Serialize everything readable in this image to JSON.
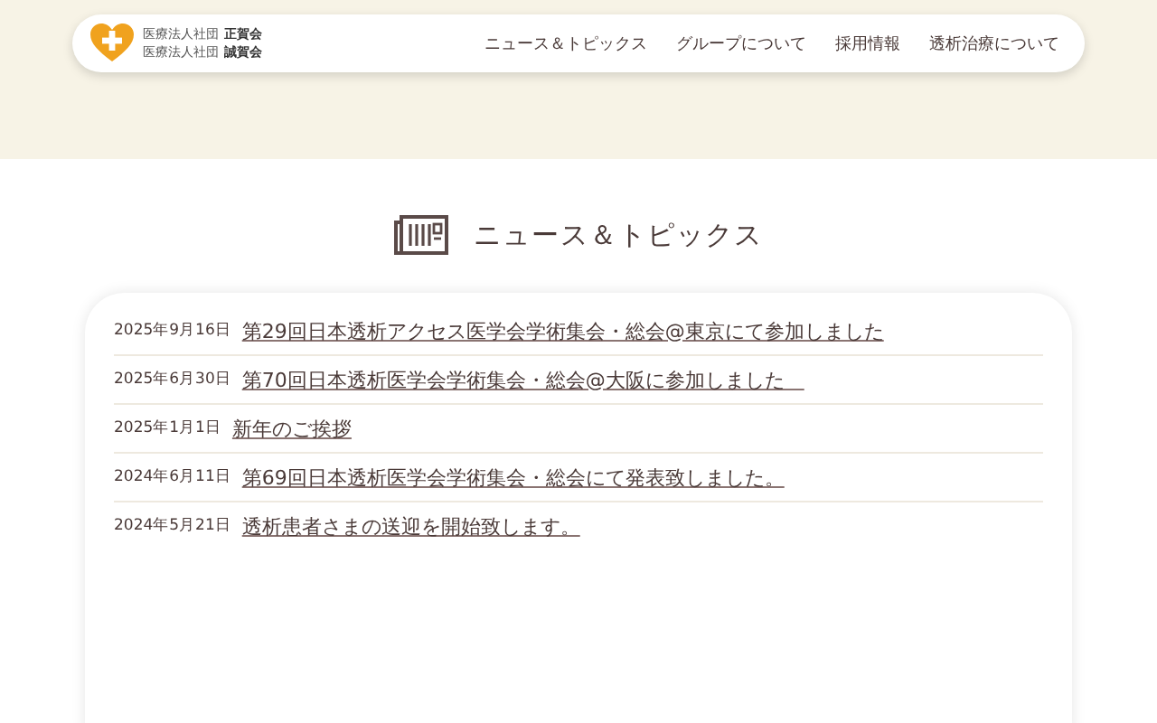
{
  "logo": {
    "lines": [
      {
        "prefix": "医療法人社団",
        "name": "正賀会"
      },
      {
        "prefix": "医療法人社団",
        "name": "誠賀会"
      }
    ]
  },
  "nav": [
    "ニュース＆トピックス",
    "グループについて",
    "採用情報",
    "透析治療について"
  ],
  "section_title": "ニュース＆トピックス",
  "news": [
    {
      "date": "2025年9月16日",
      "title": "第29回日本透析アクセス医学会学術集会・総会@東京にて参加しました"
    },
    {
      "date": "2025年6月30日",
      "title": "第70回日本透析医学会学術集会・総会@大阪に参加しました　"
    },
    {
      "date": "2025年1月1日",
      "title": "新年のご挨拶"
    },
    {
      "date": "2024年6月11日",
      "title": "第69回日本透析医学会学術集会・総会にて発表致しました。"
    },
    {
      "date": "2024年5月21日",
      "title": "透析患者さまの送迎を開始致します。"
    }
  ]
}
